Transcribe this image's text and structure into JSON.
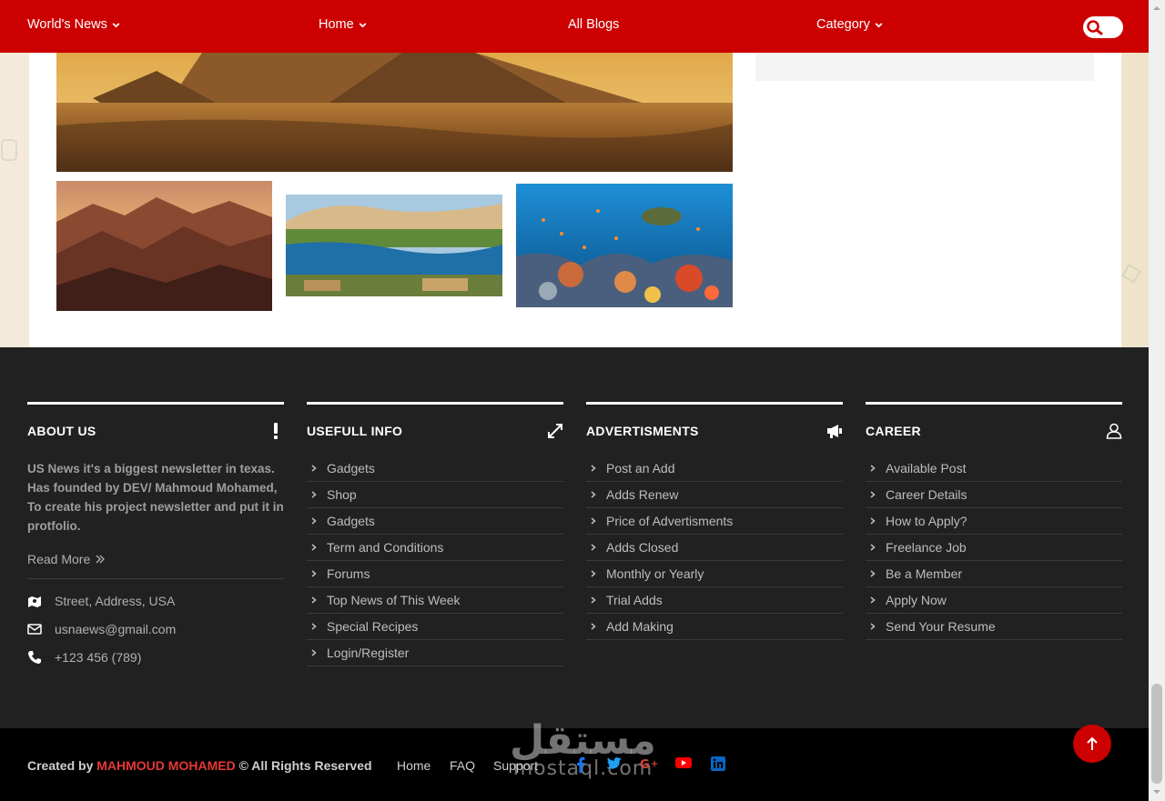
{
  "nav": {
    "items": [
      {
        "label": "World's News",
        "has_dropdown": true
      },
      {
        "label": "Home",
        "has_dropdown": true
      },
      {
        "label": "All Blogs",
        "has_dropdown": false
      },
      {
        "label": "Category",
        "has_dropdown": true
      }
    ],
    "search_icon": "search-icon",
    "color": "#cc0000"
  },
  "gallery": {
    "hero_alt": "pyramids-image",
    "thumbs": [
      "mountains-image",
      "nile-river-image",
      "coral-reef-image"
    ]
  },
  "footer": {
    "about": {
      "title": "ABOUT US",
      "icon": "exclamation-icon",
      "text": "US News it's a biggest newsletter in texas. Has founded by DEV/ Mahmoud Mohamed, To create his project newsletter and put it in protfolio.",
      "read_more": "Read More",
      "address": "Street, Address, USA",
      "email": "usnaews@gmail.com",
      "phone": "+123 456 (789)"
    },
    "useful": {
      "title": "USEFULL INFO",
      "icon": "expand-icon",
      "links": [
        "Gadgets",
        "Shop",
        "Gadgets",
        "Term and Conditions",
        "Forums",
        "Top News of This Week",
        "Special Recipes",
        "Login/Register"
      ]
    },
    "ads": {
      "title": "ADVERTISMENTS",
      "icon": "megaphone-icon",
      "links": [
        "Post an Add",
        "Adds Renew",
        "Price of Advertisments",
        "Adds Closed",
        "Monthly or Yearly",
        "Trial Adds",
        "Add Making"
      ]
    },
    "career": {
      "title": "CAREER",
      "icon": "user-icon",
      "links": [
        "Available Post",
        "Career Details",
        "How to Apply?",
        "Freelance Job",
        "Be a Member",
        "Apply Now",
        "Send Your Resume"
      ]
    }
  },
  "bottom": {
    "created_by": "Created by",
    "author": "MAHMOUD MOHAMED",
    "rights": "© All Rights Reserved",
    "links": [
      "Home",
      "FAQ",
      "Support"
    ],
    "social": [
      "facebook-icon",
      "twitter-icon",
      "google-plus-icon",
      "youtube-icon",
      "linkedin-icon"
    ],
    "watermark_ar": "مستقل",
    "watermark_lat": "mostaql.com"
  },
  "colors": {
    "accent": "#cc0000",
    "footer_bg": "#212121",
    "author": "#e53935"
  }
}
